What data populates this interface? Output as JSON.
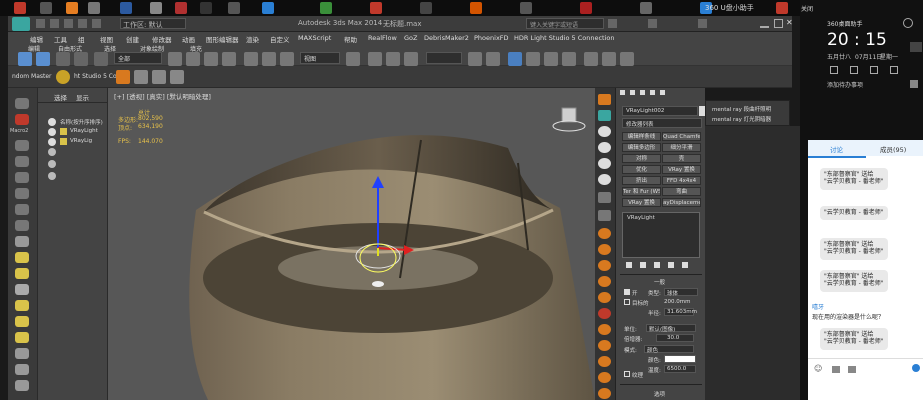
{
  "desktop": {
    "top_right_label": "360 U盘小助手",
    "side_label": "关闭"
  },
  "titlebar": {
    "workspace_label": "工作区: 默认",
    "app_title": "Autodesk 3ds Max 2014",
    "file_title": "无标题.max",
    "search_placeholder": "键入关键字或短语"
  },
  "menubar": {
    "items": [
      "编辑",
      "工具",
      "组",
      "视图",
      "创建",
      "修改器",
      "动画",
      "图形编辑器",
      "渲染",
      "自定义",
      "MAXScript",
      "帮助",
      "RealFlow",
      "GoZ",
      "DebrisMaker2",
      "PhoenixFD",
      "HDR Light Studio 5 Connection"
    ]
  },
  "menubar2": {
    "items": [
      "编辑",
      "自由形式",
      "选择",
      "对象绘制",
      "填充"
    ]
  },
  "toolbar": {
    "selection_filter": "全部",
    "view_dropdown": "视图"
  },
  "toolbar2": {
    "random_master": "ndom Master",
    "hdr_label": "ht Studio 5 Co"
  },
  "explorer": {
    "tab_select": "选择",
    "tab_display": "显示",
    "macro": "Macro2",
    "sort_header": "名称(按升序排序)",
    "items": [
      "VRayLight",
      "VRayLig"
    ]
  },
  "viewport": {
    "label": "[+] [透视] [真实] [默认明暗处理]",
    "stats": {
      "total_label": "总计",
      "polys_label": "多边形:",
      "polys_value": "802,590",
      "verts_label": "顶点:",
      "verts_value": "634,190",
      "fps_label": "FPS:",
      "fps_value": "144.070"
    }
  },
  "cmdpanel": {
    "object_name": "VRayLight002",
    "modifier_list": "修改器列表",
    "buttons": [
      "编辑样条线",
      "Quad Chamfer",
      "编辑多边形",
      "细分平滑",
      "对称",
      "壳",
      "优化",
      "VRay 置换",
      "挤出",
      "FFD 4x4x4",
      "Ter 和 Fur (WSM)",
      "弯曲",
      "VRay 置换",
      "ayDisplacementM"
    ],
    "stack_item": "VRayLight",
    "rollout_general": "一般",
    "on_label": "开",
    "type_label": "类型:",
    "type_value": "球体",
    "targeted_label": "目标的",
    "target_dist": "200.0mm",
    "radius_label": "半径:",
    "radius_value": "31.603mm",
    "unit_label": "单位:",
    "unit_value": "默认(图像)",
    "multiplier_label": "倍增器:",
    "multiplier_value": "30.0",
    "mode_label": "模式:",
    "mode_value": "颜色",
    "color_label": "颜色:",
    "temp_label": "温度:",
    "temp_value": "6500.0",
    "texture_label": "纹理",
    "options_label": "选项"
  },
  "modpopup": {
    "items": [
      "mental ray 段曲杆照明",
      "mental ray 灯光阴暗器"
    ]
  },
  "chat": {
    "tab_discuss": "讨论",
    "tab_members": "成员(95)",
    "messages": [
      {
        "text": "\"东部督察官\" 送给",
        "sub": "\"云学贝教育 - 番老师\""
      },
      {
        "text": "\"云学贝教育 - 番老师\"",
        "sub": ""
      },
      {
        "text": "\"东部督察官\" 送给",
        "sub": "\"云学贝教育 - 番老师\""
      },
      {
        "text": "\"东部督察官\" 送给",
        "sub": "\"云学贝教育 - 番老师\""
      }
    ],
    "user_name": "嘻牙",
    "user_msg": "现在用的渲染器是什么呢？",
    "last_msg": {
      "text": "\"东部督察官\" 送给",
      "sub": "\"云学贝教育 - 番老师\""
    }
  },
  "clock": {
    "time": "20 : 15",
    "day": "五月廿八",
    "date": "07月11日",
    "weekday": "星期一",
    "reminder": "添加待办事项"
  },
  "widget_title": "360桌面助手",
  "colors": {
    "accent_orange": "#d8791f",
    "stats_yellow": "#e8c24a",
    "panel_gray": "#444444"
  }
}
